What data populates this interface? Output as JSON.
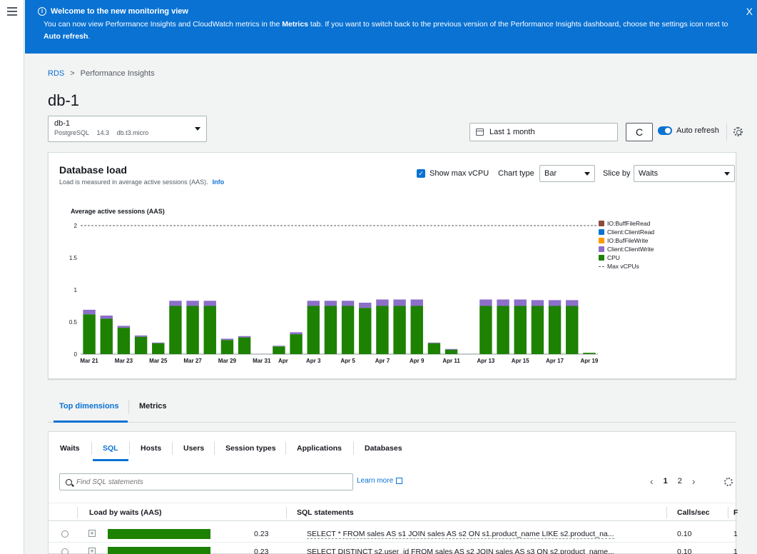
{
  "banner": {
    "title": "Welcome to the new monitoring view",
    "message_prefix": "You can now view Performance Insights and CloudWatch metrics in the ",
    "message_bold1": "Metrics",
    "message_mid": " tab. If you want to switch back to the previous version of the Performance Insights dashboard, choose the settings icon next to ",
    "message_bold2": "Auto refresh",
    "message_suffix": ".",
    "close": "X"
  },
  "breadcrumb": {
    "root": "RDS",
    "current": "Performance Insights"
  },
  "page": {
    "title": "db-1"
  },
  "db_selector": {
    "name": "db-1",
    "engine": "PostgreSQL",
    "version": "14.3",
    "instance": "db.t3.micro"
  },
  "toolbar": {
    "time_range": "Last 1 month",
    "refresh_glyph": "C",
    "auto_refresh_label": "Auto refresh"
  },
  "db_load": {
    "title": "Database load",
    "subtitle": "Load is measured in average active sessions (AAS).",
    "info": "Info",
    "show_max_vcpu_label": "Show max vCPU",
    "chart_type_label": "Chart type",
    "chart_type_value": "Bar",
    "slice_by_label": "Slice by",
    "slice_by_value": "Waits"
  },
  "chart_data": {
    "type": "bar",
    "title": "Average active sessions (AAS)",
    "stacked": true,
    "ylim": [
      0,
      2
    ],
    "yticks": [
      "0",
      "0.5",
      "1",
      "1.5",
      "2"
    ],
    "max_vcpus": 2,
    "categories": [
      "Mar 21",
      "Mar 22",
      "Mar 23",
      "Mar 24",
      "Mar 25",
      "Mar 26",
      "Mar 27",
      "Mar 28",
      "Mar 29",
      "Mar 30",
      "Mar 31",
      "Apr 1",
      "Apr 2",
      "Apr 3",
      "Apr 4",
      "Apr 5",
      "Apr 6",
      "Apr 7",
      "Apr 8",
      "Apr 9",
      "Apr 10",
      "Apr 11",
      "Apr 12",
      "Apr 13",
      "Apr 14",
      "Apr 15",
      "Apr 16",
      "Apr 17",
      "Apr 18",
      "Apr 19"
    ],
    "xtick_labels": [
      "Mar 21",
      "Mar 23",
      "Mar 25",
      "Mar 27",
      "Mar 29",
      "Mar 31",
      "Apr",
      "Apr 3",
      "Apr 5",
      "Apr 7",
      "Apr 9",
      "Apr 11",
      "Apr 13",
      "Apr 15",
      "Apr 17",
      "Apr 19"
    ],
    "series": [
      {
        "name": "CPU",
        "color": "#1d8102",
        "values": [
          0.62,
          0.55,
          0.41,
          0.27,
          0.17,
          0.75,
          0.75,
          0.75,
          0.22,
          0.26,
          0,
          0.12,
          0.31,
          0.75,
          0.75,
          0.75,
          0.72,
          0.75,
          0.75,
          0.75,
          0.17,
          0.07,
          0,
          0.75,
          0.75,
          0.75,
          0.75,
          0.75,
          0.75,
          0.02
        ]
      },
      {
        "name": "Client:ClientWrite",
        "color": "#8c6fc9",
        "values": [
          0.07,
          0.05,
          0.03,
          0.02,
          0.01,
          0.08,
          0.08,
          0.08,
          0.02,
          0.02,
          0,
          0.01,
          0.03,
          0.08,
          0.08,
          0.08,
          0.08,
          0.1,
          0.1,
          0.1,
          0.01,
          0.01,
          0,
          0.1,
          0.1,
          0.1,
          0.09,
          0.09,
          0.09,
          0
        ]
      }
    ],
    "legend": [
      {
        "name": "IO:BuffFileRead",
        "color": "#8c4b3b"
      },
      {
        "name": "Client:ClientRead",
        "color": "#0972d3"
      },
      {
        "name": "IO:BufFileWrite",
        "color": "#ff9900"
      },
      {
        "name": "Client:ClientWrite",
        "color": "#8c6fc9"
      },
      {
        "name": "CPU",
        "color": "#1d8102"
      },
      {
        "name": "Max vCPUs",
        "color": "#545b64"
      }
    ]
  },
  "main_tabs": [
    {
      "label": "Top dimensions"
    },
    {
      "label": "Metrics"
    }
  ],
  "sub_tabs": [
    {
      "label": "Waits"
    },
    {
      "label": "SQL"
    },
    {
      "label": "Hosts"
    },
    {
      "label": "Users"
    },
    {
      "label": "Session types"
    },
    {
      "label": "Applications"
    },
    {
      "label": "Databases"
    }
  ],
  "search": {
    "placeholder": "Find SQL statements"
  },
  "learn_more": "Learn more",
  "pager": {
    "prev": "‹",
    "page1": "1",
    "page2": "2",
    "next": "›"
  },
  "table": {
    "headers": {
      "load": "Load by waits (AAS)",
      "sql": "SQL statements",
      "calls": "Calls/sec",
      "extra": "F"
    },
    "rows": [
      {
        "load_value": "0.23",
        "load_fraction": 0.72,
        "sql": "SELECT * FROM sales AS s1 JOIN sales AS s2 ON s1.product_name LIKE s2.product_na...",
        "calls": "0.10",
        "extra": "1"
      },
      {
        "load_value": "0.23",
        "load_fraction": 0.72,
        "sql": "SELECT DISTINCT s2.user_id FROM sales AS s2 JOIN sales AS s3 ON s2.product_name...",
        "calls": "0.10",
        "extra": "1"
      }
    ]
  }
}
